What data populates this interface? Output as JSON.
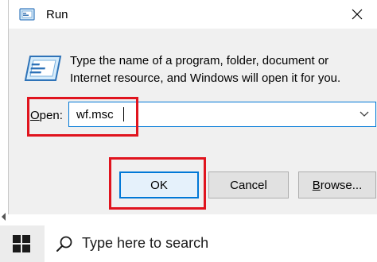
{
  "window": {
    "title": "Run",
    "icon": "run-icon",
    "close_icon": "close-icon"
  },
  "description": "Type the name of a program, folder, document or Internet resource, and Windows will open it for you.",
  "open": {
    "label_underlined": "O",
    "label_rest": "pen:",
    "value": "wf.msc",
    "dropdown_icon": "chevron-down-icon"
  },
  "buttons": {
    "ok": "OK",
    "cancel": "Cancel",
    "browse_underlined": "B",
    "browse_rest": "rowse..."
  },
  "taskbar": {
    "start_icon": "windows-logo-icon",
    "search_icon": "search-icon",
    "search_placeholder": "Type here to search"
  },
  "colors": {
    "highlight": "#e0141e",
    "accent": "#0078d7",
    "dialog_bg": "#f0f0f0",
    "taskbar_bg": "#ececec"
  }
}
